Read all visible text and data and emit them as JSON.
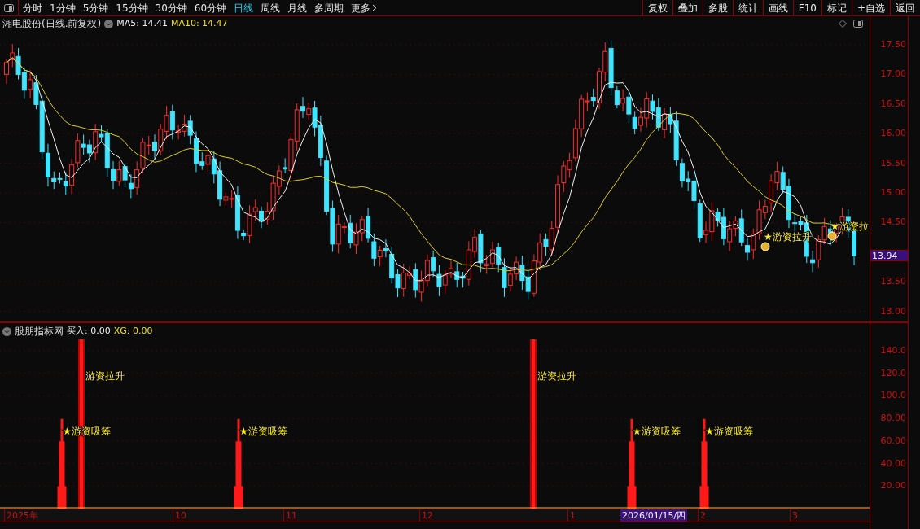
{
  "toolbar": {
    "periods": [
      {
        "label": "分时",
        "selected": false
      },
      {
        "label": "1分钟",
        "selected": false
      },
      {
        "label": "5分钟",
        "selected": false
      },
      {
        "label": "15分钟",
        "selected": false
      },
      {
        "label": "30分钟",
        "selected": false
      },
      {
        "label": "60分钟",
        "selected": false
      },
      {
        "label": "日线",
        "selected": true
      },
      {
        "label": "周线",
        "selected": false
      },
      {
        "label": "月线",
        "selected": false
      },
      {
        "label": "多周期",
        "selected": false
      }
    ],
    "more": "更多",
    "buttons": [
      "复权",
      "叠加",
      "多股",
      "统计",
      "画线",
      "F10",
      "标记",
      "+自选",
      "返回"
    ]
  },
  "header": {
    "title": "湘电股份(日线.前复权)",
    "ma5": "MA5: 14.41",
    "ma10": "MA10: 14.47"
  },
  "price_axis": {
    "ticks": [
      "17.50",
      "17.00",
      "16.50",
      "16.00",
      "15.50",
      "15.00",
      "14.50",
      "13.50",
      "13.00"
    ],
    "current_price": "13.94"
  },
  "signals": [
    {
      "label": "★游资拉升"
    },
    {
      "label": "★游资拉"
    }
  ],
  "indicator": {
    "title": "股朋指标网",
    "buy": "买入: 0.00",
    "xg": "XG: 0.00",
    "ticks": [
      "140.0",
      "120.0",
      "100.0",
      "80.00",
      "60.00",
      "40.00",
      "20.00"
    ],
    "bars": [
      {
        "kind": "stepped",
        "label": "★游资吸筹"
      },
      {
        "kind": "tall",
        "label": "游资拉升"
      },
      {
        "kind": "stepped",
        "label": "★游资吸筹"
      },
      {
        "kind": "tall",
        "label": "游资拉升"
      },
      {
        "kind": "stepped",
        "label": "★游资吸筹"
      },
      {
        "kind": "stepped",
        "label": "★游资吸筹"
      }
    ]
  },
  "time_axis": [
    {
      "label": "2025年",
      "selected": false
    },
    {
      "label": "10",
      "selected": false
    },
    {
      "label": "11",
      "selected": false
    },
    {
      "label": "12",
      "selected": false
    },
    {
      "label": "1",
      "selected": false
    },
    {
      "label": "2026/01/15/四",
      "selected": true
    },
    {
      "label": "2",
      "selected": false
    },
    {
      "label": "3",
      "selected": false
    }
  ]
}
